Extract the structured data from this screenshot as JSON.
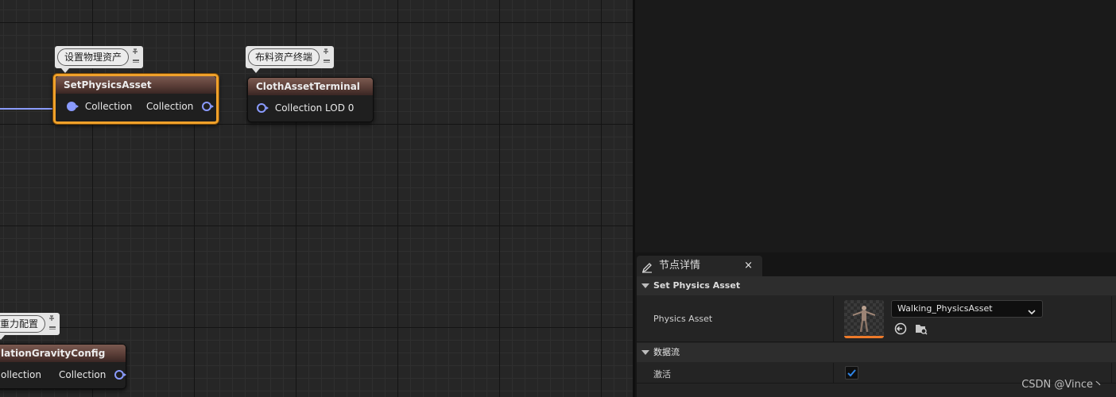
{
  "graph": {
    "nodes": {
      "set_physics_asset": {
        "comment": "设置物理资产",
        "title": "SetPhysicsAsset",
        "input_pin": "Collection",
        "output_pin": "Collection"
      },
      "cloth_asset_terminal": {
        "comment": "布料资产终端",
        "title": "ClothAssetTerminal",
        "input_pin": "Collection LOD 0"
      },
      "gravity_config": {
        "comment": "重力配置",
        "title": "lationGravityConfig",
        "input_pin": "ollection",
        "output_pin": "Collection"
      }
    },
    "wire_color": "#8a9bff",
    "selection_color": "#f0a12a"
  },
  "details": {
    "tab_label": "节点详情",
    "tab_close": "×",
    "sections": {
      "set_physics_asset": {
        "label": "Set Physics Asset",
        "physics_asset_label": "Physics Asset",
        "physics_asset_value": "Walking_PhysicsAsset"
      },
      "dataflow": {
        "label": "数据流",
        "active_label": "激活",
        "active_checked": true
      }
    }
  },
  "watermark": "CSDN @Vince丶"
}
